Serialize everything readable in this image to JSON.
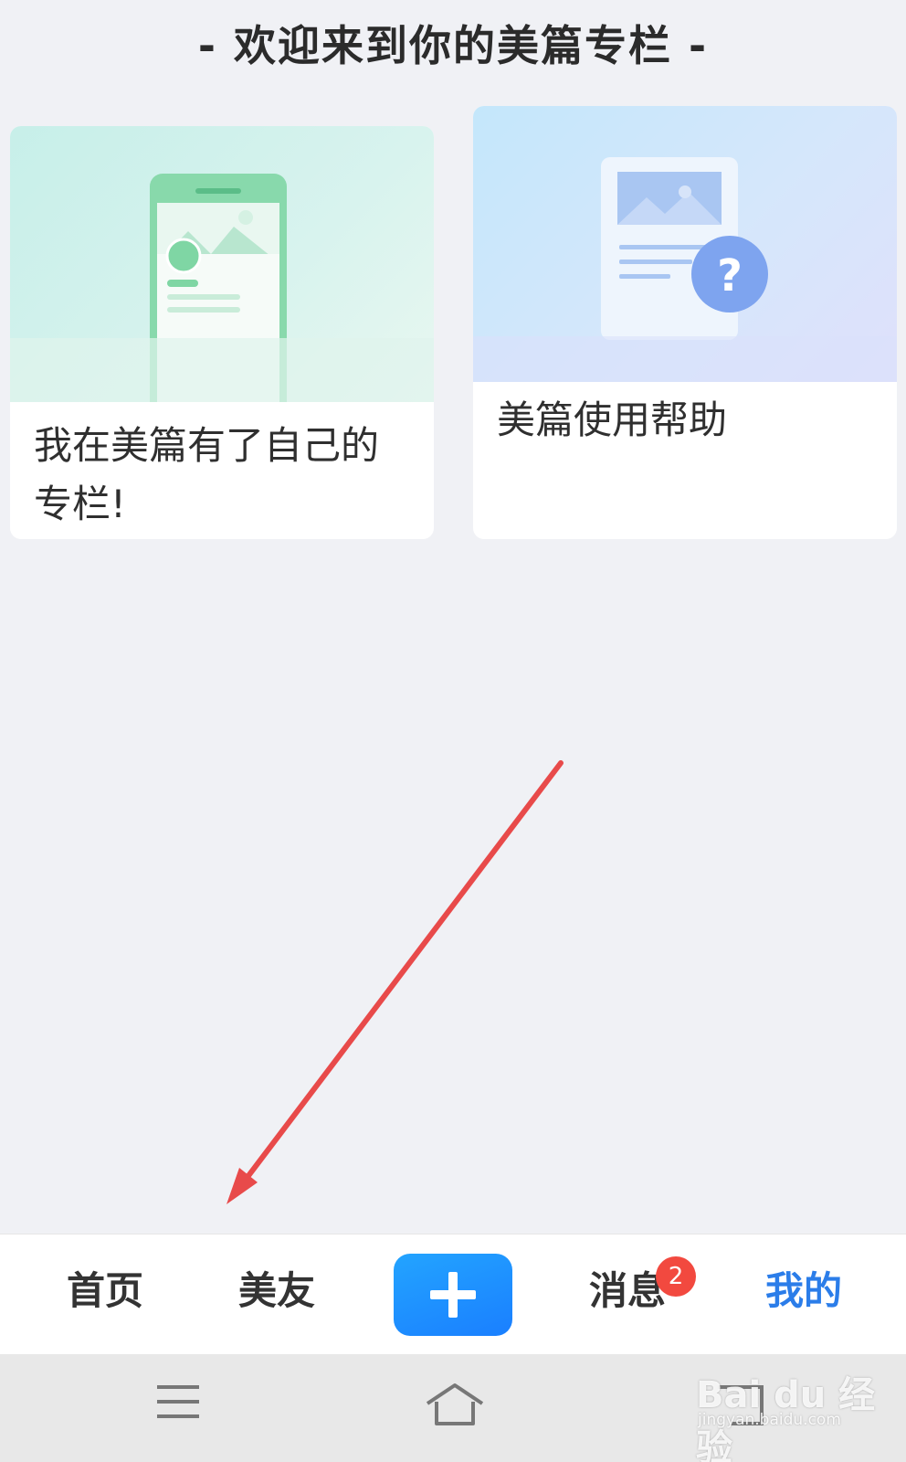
{
  "header": {
    "title": "- 欢迎来到你的美篇专栏 -"
  },
  "cards": [
    {
      "title": "我在美篇有了自己的专栏!"
    },
    {
      "title": "美篇使用帮助"
    }
  ],
  "tabbar": {
    "home_label": "首页",
    "friends_label": "美友",
    "add_icon": "plus-icon",
    "messages_label": "消息",
    "messages_badge": "2",
    "mine_label": "我的",
    "active_color": "#2b7de9",
    "badge_color": "#f2493f",
    "add_button_color": "#1a8cff"
  },
  "system_nav": {
    "icons": [
      "menu-icon",
      "home-icon",
      "back-icon"
    ]
  },
  "annotation": {
    "arrow_color": "#e84a4a"
  },
  "watermark": {
    "text": "Bai du 经验",
    "sub": "jingyan.baidu.com"
  }
}
